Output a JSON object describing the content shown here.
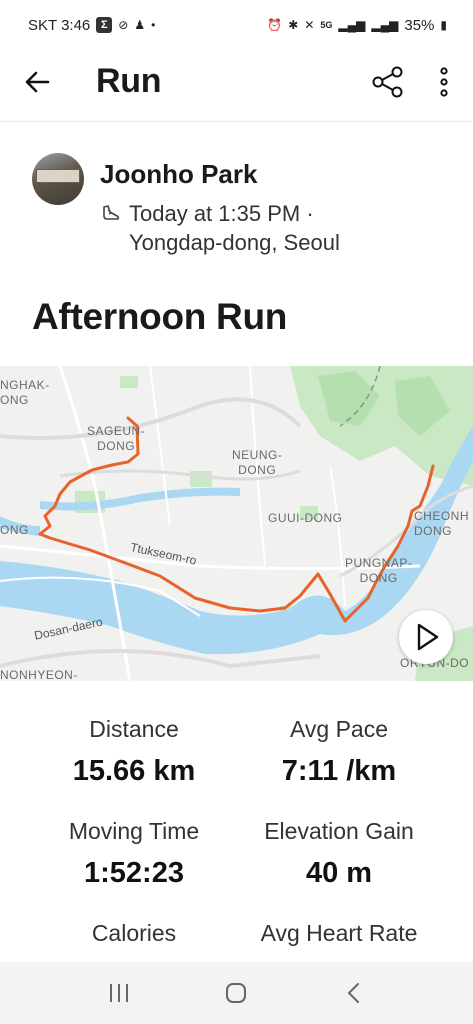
{
  "status_bar": {
    "carrier_time": "SKT 3:46",
    "battery": "35%",
    "icons": [
      "sigma-icon",
      "sync-off-icon",
      "person-icon",
      "dot-icon",
      "alarm-icon",
      "bluetooth-icon",
      "mute-icon",
      "5g-icon",
      "signal-icon",
      "signal-icon",
      "battery-icon"
    ]
  },
  "header": {
    "title": "Run",
    "back_icon": "arrow-left-icon",
    "share_icon": "share-icon",
    "more_icon": "more-vertical-icon"
  },
  "athlete": {
    "name": "Joonho Park",
    "when": "Today at 1:35 PM ·",
    "where": "Yongdap-dong, Seoul",
    "activity_icon": "shoe-icon"
  },
  "activity": {
    "title": "Afternoon Run"
  },
  "map": {
    "labels": {
      "nghak": "NGHAK-\nONG",
      "sageun": "SAGEUN-\nDONG",
      "neung": "NEUNG-\nDONG",
      "guui": "GUUI-DONG",
      "cheonh": "CHEONH\nDONG",
      "ong": "ONG",
      "ttukseom": "Ttukseom-ro",
      "pungnap": "PUNGNAP-\nDONG",
      "dosan": "Dosan-daero",
      "nonhyeon": "NONHYEON-",
      "oryun": "ORYUN-DO"
    },
    "route_color": "#e8622c",
    "water_color": "#aad8f2",
    "park_color": "#c9e8c3",
    "play_icon": "play-icon"
  },
  "stats": [
    {
      "label": "Distance",
      "value": "15.66 km"
    },
    {
      "label": "Avg Pace",
      "value": "7:11 /km"
    },
    {
      "label": "Moving Time",
      "value": "1:52:23"
    },
    {
      "label": "Elevation Gain",
      "value": "40 m"
    },
    {
      "label": "Calories",
      "value": ""
    },
    {
      "label": "Avg Heart Rate",
      "value": ""
    }
  ],
  "nav": {
    "recents_icon": "recents-icon",
    "home_icon": "home-icon",
    "back_icon": "nav-back-icon"
  }
}
